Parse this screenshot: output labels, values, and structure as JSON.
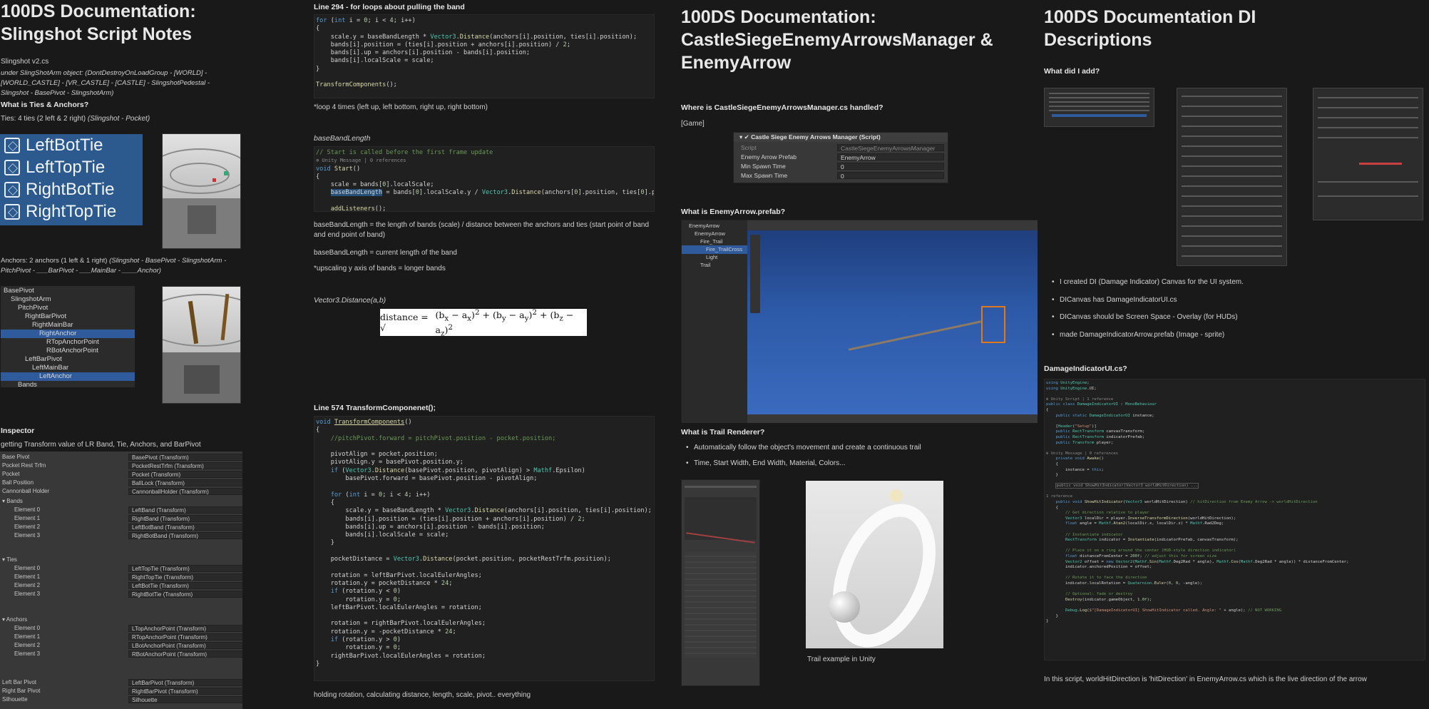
{
  "col1": {
    "title": "100DS Documentation: Slingshot Script Notes",
    "file": "Slingshot v2.cs",
    "path": "under SlingShotArm object: (DontDestroyOnLoadGroup - [WORLD] - [WORLD_CASTLE] - [VR_CASTLE] - [CASTLE] - SlingshotPedestal - Slingshot - BasePivot - SlingshotArm)",
    "ties_heading": "What is Ties & Anchors?",
    "ties_text": "Ties: 4 ties (2 left & 2 right)",
    "ties_path": "(Slingshot - Pocket)",
    "tie_items": [
      "LeftBotTie",
      "LeftTopTie",
      "RightBotTie",
      "RightTopTie"
    ],
    "anchors_text": "Anchors: 2 anchors (1 left & 1 right)",
    "anchors_path": "(Slingshot - BasePivot - SlingshotArm - PitchPivot - ___BarPivot - ___MainBar - ____Anchor)",
    "hierarchy": [
      "BasePivot",
      "SlingshotArm",
      "PitchPivot",
      "RightBarPivot",
      "RightMainBar",
      "RightAnchor",
      "RTopAnchorPoint",
      "RBotAnchorPoint",
      "LeftBarPivot",
      "LeftMainBar",
      "LeftAnchor",
      "Bands"
    ],
    "inspector_heading": "Inspector",
    "inspector_text": "getting Transform value of LR Band, Tie, Anchors, and BarPivot",
    "inspector_rows": [
      {
        "k": "Base Pivot",
        "v": "BasePivot (Transform)"
      },
      {
        "k": "Pocket Rest Trfm",
        "v": "PocketRestTrfm (Transform)"
      },
      {
        "k": "Pocket",
        "v": "Pocket (Transform)"
      },
      {
        "k": "Ball Position",
        "v": "BallLock (Transform)"
      },
      {
        "k": "Cannonball Holder",
        "v": "CannonballHolder (Transform)"
      }
    ],
    "bands_label": "Bands",
    "bands_count": "4",
    "bands": [
      "LeftBand (Transform)",
      "RightBand (Transform)",
      "LeftBotBand (Transform)",
      "RightBotBand (Transform)"
    ],
    "ties_label": "Ties",
    "ties_count": "4",
    "ties": [
      "LeftTopTie (Transform)",
      "RightTopTie (Transform)",
      "LeftBotTie (Transform)",
      "RightBotTie (Transform)"
    ],
    "anchors_label": "Anchors",
    "anchors_count": "4",
    "anchors": [
      "LTopAnchorPoint (Transform)",
      "RTopAnchorPoint (Transform)",
      "LBotAnchorPoint (Transform)",
      "RBotAnchorPoint (Transform)"
    ],
    "elements": [
      "Element 0",
      "Element 1",
      "Element 2",
      "Element 3"
    ],
    "tail_rows": [
      {
        "k": "Left Bar Pivot",
        "v": "LeftBarPivot (Transform)"
      },
      {
        "k": "Right Bar Pivot",
        "v": "RightBarPivot (Transform)"
      },
      {
        "k": "Silhouette",
        "v": "Silhouette"
      }
    ]
  },
  "col2": {
    "line294_heading": "Line 294 - for loops about pulling the band",
    "loop_note": "*loop 4 times (left up, left bottom, right up, right bottom)",
    "basebandlength_heading": "baseBandLength",
    "basebandlength_desc": "baseBandLength = the length of bands (scale) / distance between the anchors and ties (start point of band and end point of band)",
    "basebandlength_current": "baseBandLength = current length of the band",
    "upscaling_note": "*upscaling y axis of bands = longer bands",
    "vector3_heading": "Vector3.Distance(a,b)",
    "line574_heading": "Line 574 TransformComponenet();",
    "summary": "holding rotation, calculating distance, length, scale, pivot.. everything"
  },
  "col3": {
    "title": "100DS Documentation: CastleSiegeEnemyArrowsManager & EnemyArrow",
    "where_heading": "Where is CastleSiegeEnemyArrowsManager.cs handled?",
    "where_text": "[Game]",
    "component_title": "Castle Siege Enemy Arrows Manager (Script)",
    "component_rows": [
      {
        "k": "Script",
        "v": "CastleSiegeEnemyArrowsManager"
      },
      {
        "k": "Enemy Arrow Prefab",
        "v": "EnemyArrow"
      },
      {
        "k": "Min Spawn Time",
        "v": "0"
      },
      {
        "k": "Max Spawn Time",
        "v": "0"
      }
    ],
    "prefab_heading": "What is EnemyArrow.prefab?",
    "prefab_tree": [
      "EnemyArrow",
      "EnemyArrow",
      "Fire_Trail",
      "Fire_TrailCross",
      "Light",
      "Trail"
    ],
    "trail_heading": "What is Trail Renderer?",
    "trail_bullets": [
      "Automatically follow the object's movement and create a continuous trail",
      "Time, Start Width, End Width, Material, Colors..."
    ],
    "trail_caption": "Trail example in Unity"
  },
  "col4": {
    "title": "100DS Documentation DI Descriptions",
    "added_heading": "What did I add?",
    "bullets": [
      "I created DI (Damage Indicator) Canvas for the UI system.",
      "DICanvas has DamageIndicatorUI.cs",
      "DICanvas should be Screen Space - Overlay (for HUDs)",
      "made DamageIndicatorArrow.prefab (Image - sprite)"
    ],
    "script_heading": "DamageIndicatorUI.cs?",
    "footer": "In this script, worldHitDirection is 'hitDirection' in EnemyArrow.cs which is the live direction of the arrow"
  }
}
